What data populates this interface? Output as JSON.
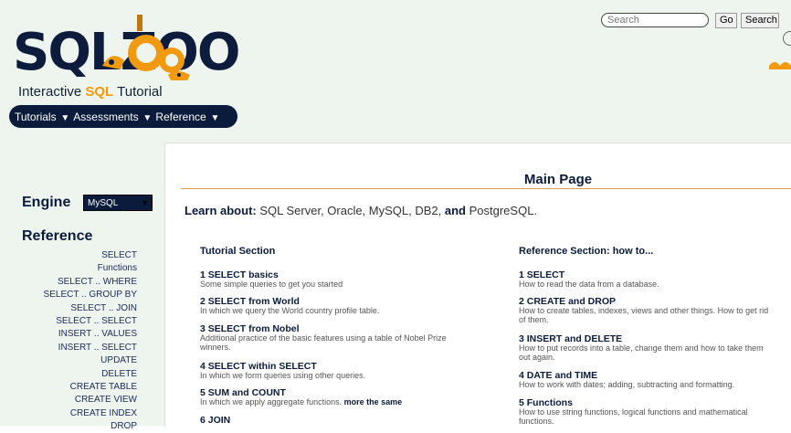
{
  "header": {
    "logo_text": "SQLZOO",
    "subtitle_prefix": "Interactive ",
    "subtitle_sql": "SQL",
    "subtitle_suffix": " Tutorial"
  },
  "nav": [
    {
      "label": "Tutorials"
    },
    {
      "label": "Assessments"
    },
    {
      "label": "Reference"
    }
  ],
  "search": {
    "placeholder": "Search",
    "go_label": "Go",
    "search_label": "Search"
  },
  "sidebar": {
    "engine_label": "Engine",
    "engine_value": "MySQL",
    "reference_heading": "Reference",
    "items": [
      "SELECT",
      "Functions",
      "SELECT .. WHERE",
      "SELECT .. GROUP BY",
      "SELECT .. JOIN",
      "SELECT .. SELECT",
      "INSERT .. VALUES",
      "INSERT .. SELECT",
      "UPDATE",
      "DELETE",
      "CREATE TABLE",
      "CREATE VIEW",
      "CREATE INDEX",
      "DROP"
    ]
  },
  "main": {
    "title": "Main Page",
    "learn_label": "Learn about:",
    "learn_text": " SQL Server, Oracle, MySQL, DB2, ",
    "learn_and": "and",
    "learn_last": " PostgreSQL."
  },
  "tutorial_section": {
    "heading": "Tutorial Section",
    "entries": [
      {
        "title": "1 SELECT basics",
        "desc": "Some simple queries to get you started"
      },
      {
        "title": "2 SELECT from World",
        "desc": "In which we query the World country profile table."
      },
      {
        "title": "3 SELECT from Nobel",
        "desc": "Additional practice of the basic features using a table of Nobel Prize",
        "desc2": "winners."
      },
      {
        "title": "4 SELECT within SELECT",
        "desc": "In which we form queries using other queries."
      },
      {
        "title": "5 SUM and COUNT",
        "desc": "In which we apply aggregate functions.",
        "extra": "more the same"
      },
      {
        "title": "6 JOIN"
      }
    ]
  },
  "reference_section": {
    "heading": "Reference Section: how to...",
    "entries": [
      {
        "title": "1 SELECT",
        "desc": "How to read the data from a database."
      },
      {
        "title": "2 CREATE and DROP",
        "desc": "How to create tables, indexes, views and other things. How to get rid",
        "desc2": "of them."
      },
      {
        "title": "3 INSERT and DELETE",
        "desc": "How to put records into a table, change them and how to take them",
        "desc2": "out again."
      },
      {
        "title": "4 DATE and TIME",
        "desc": "How to work with dates; adding, subtracting and formatting."
      },
      {
        "title": "5 Functions",
        "desc": "How to use string functions, logical functions and mathematical",
        "desc2": "functions."
      }
    ]
  },
  "colors": {
    "navy": "#0b1b3b",
    "accent_orange": "#f29a0f",
    "header_bg": "#eef5ee"
  }
}
